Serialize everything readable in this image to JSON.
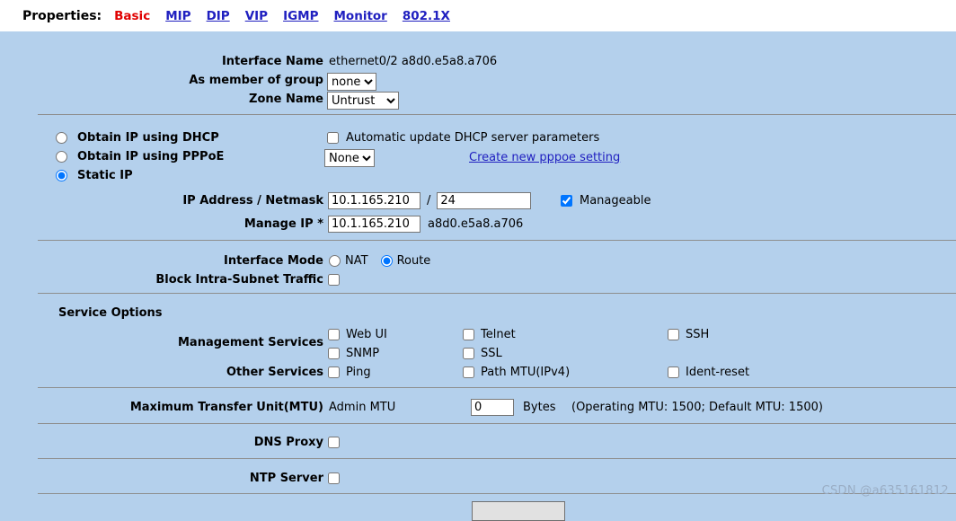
{
  "header": {
    "properties_label": "Properties:",
    "tabs": [
      {
        "label": "Basic",
        "active": true
      },
      {
        "label": "MIP",
        "active": false
      },
      {
        "label": "DIP",
        "active": false
      },
      {
        "label": "VIP",
        "active": false
      },
      {
        "label": "IGMP",
        "active": false
      },
      {
        "label": "Monitor",
        "active": false
      },
      {
        "label": "802.1X",
        "active": false
      }
    ]
  },
  "interface": {
    "name_label": "Interface Name",
    "name_value": "ethernet0/2 a8d0.e5a8.a706",
    "group_label": "As member of group",
    "group_value": "none",
    "group_options": [
      "none"
    ],
    "zone_label": "Zone Name",
    "zone_value": "Untrust",
    "zone_options": [
      "Untrust"
    ]
  },
  "ip_mode": {
    "dhcp_label": "Obtain IP using DHCP",
    "pppoe_label": "Obtain IP using PPPoE",
    "static_label": "Static IP",
    "selected": "static",
    "auto_update_label": "Automatic update DHCP server parameters",
    "auto_update_checked": false,
    "pppoe_select_value": "None",
    "pppoe_select_options": [
      "None"
    ],
    "create_pppoe_link": "Create new pppoe setting"
  },
  "addressing": {
    "ip_netmask_label": "IP Address / Netmask",
    "ip_value": "10.1.165.210",
    "slash": "/",
    "netmask_value": "24",
    "manageable_label": "Manageable",
    "manageable_checked": true,
    "manage_ip_label": "Manage IP *",
    "manage_ip_value": "10.1.165.210",
    "manage_ip_mac": "a8d0.e5a8.a706"
  },
  "mode": {
    "interface_mode_label": "Interface Mode",
    "nat_label": "NAT",
    "route_label": "Route",
    "selected": "route",
    "block_intra_label": "Block Intra-Subnet Traffic",
    "block_intra_checked": false
  },
  "service_options": {
    "title": "Service Options",
    "management_label": "Management Services",
    "other_label": "Other Services",
    "management": [
      {
        "label": "Web UI",
        "checked": false
      },
      {
        "label": "Telnet",
        "checked": false
      },
      {
        "label": "SSH",
        "checked": false
      },
      {
        "label": "SNMP",
        "checked": false
      },
      {
        "label": "SSL",
        "checked": false
      }
    ],
    "other": [
      {
        "label": "Ping",
        "checked": false
      },
      {
        "label": "Path MTU(IPv4)",
        "checked": false
      },
      {
        "label": "Ident-reset",
        "checked": false
      }
    ]
  },
  "mtu": {
    "title": "Maximum Transfer Unit(MTU)",
    "admin_label": "Admin MTU",
    "value": "0",
    "units": "Bytes",
    "note": "(Operating MTU: 1500; Default MTU: 1500)"
  },
  "dns_proxy": {
    "label": "DNS Proxy",
    "checked": false
  },
  "ntp_server": {
    "label": "NTP Server",
    "checked": false
  },
  "watermark": "CSDN @a635161812"
}
